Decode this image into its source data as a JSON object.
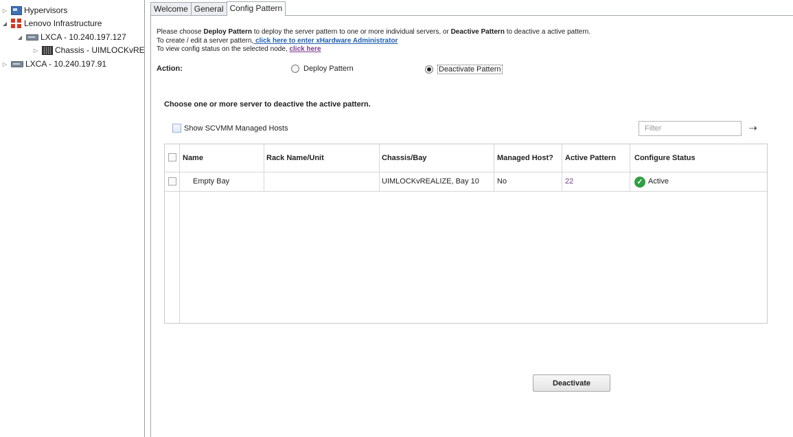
{
  "tree": {
    "items": [
      {
        "label": "Hypervisors",
        "icon": "hypervisor-icon",
        "expanded": false
      },
      {
        "label": "Lenovo Infrastructure",
        "icon": "infrastructure-icon",
        "expanded": true
      },
      {
        "label": "LXCA - 10.240.197.127",
        "icon": "server-icon",
        "expanded": true
      },
      {
        "label": "Chassis - UIMLOCKvRE",
        "icon": "chassis-icon",
        "expanded": false
      },
      {
        "label": "LXCA - 10.240.197.91",
        "icon": "server-icon",
        "expanded": false
      }
    ]
  },
  "tabs": [
    {
      "label": "Welcome",
      "active": false
    },
    {
      "label": "General",
      "active": false
    },
    {
      "label": "Config Pattern",
      "active": true
    }
  ],
  "instructions": {
    "line1": {
      "t1": "Please choose ",
      "b1": "Deploy Pattern",
      "t2": " to deploy the server pattern to one or more individual servers, or ",
      "b2": "Deactive Pattern",
      "t3": " to deactive a active pattern."
    },
    "line2": {
      "prefix": "To create / edit a server pattern,",
      "link": " click here to enter xHardware Administrator"
    },
    "line3": {
      "prefix": "To view config status on the selected node, ",
      "link": "click here"
    }
  },
  "action": {
    "label": "Action:",
    "options": [
      {
        "label": "Deploy Pattern",
        "selected": false
      },
      {
        "label": "Deactivate Pattern",
        "selected": true
      }
    ]
  },
  "choose_text": "Choose one or more server to deactive the active pattern.",
  "show_scvmm": {
    "label": "Show SCVMM Managed Hosts",
    "checked": false
  },
  "filter": {
    "placeholder": "Filter",
    "value": ""
  },
  "table": {
    "columns": [
      "Name",
      "Rack Name/Unit",
      "Chassis/Bay",
      "Managed Host?",
      "Active Pattern",
      "Configure Status"
    ],
    "rows": [
      {
        "name": "Empty Bay",
        "rack": "",
        "chassis_bay": "UIMLOCKvREALIZE, Bay 10",
        "managed": "No",
        "pattern": "22",
        "status": "Active"
      }
    ]
  },
  "deactivate_button": "Deactivate",
  "colors": {
    "link": "#1f5fb0",
    "visited_link": "#7a3a8a",
    "status_ok": "#2f9e44",
    "brand_red": "#d9381e"
  }
}
